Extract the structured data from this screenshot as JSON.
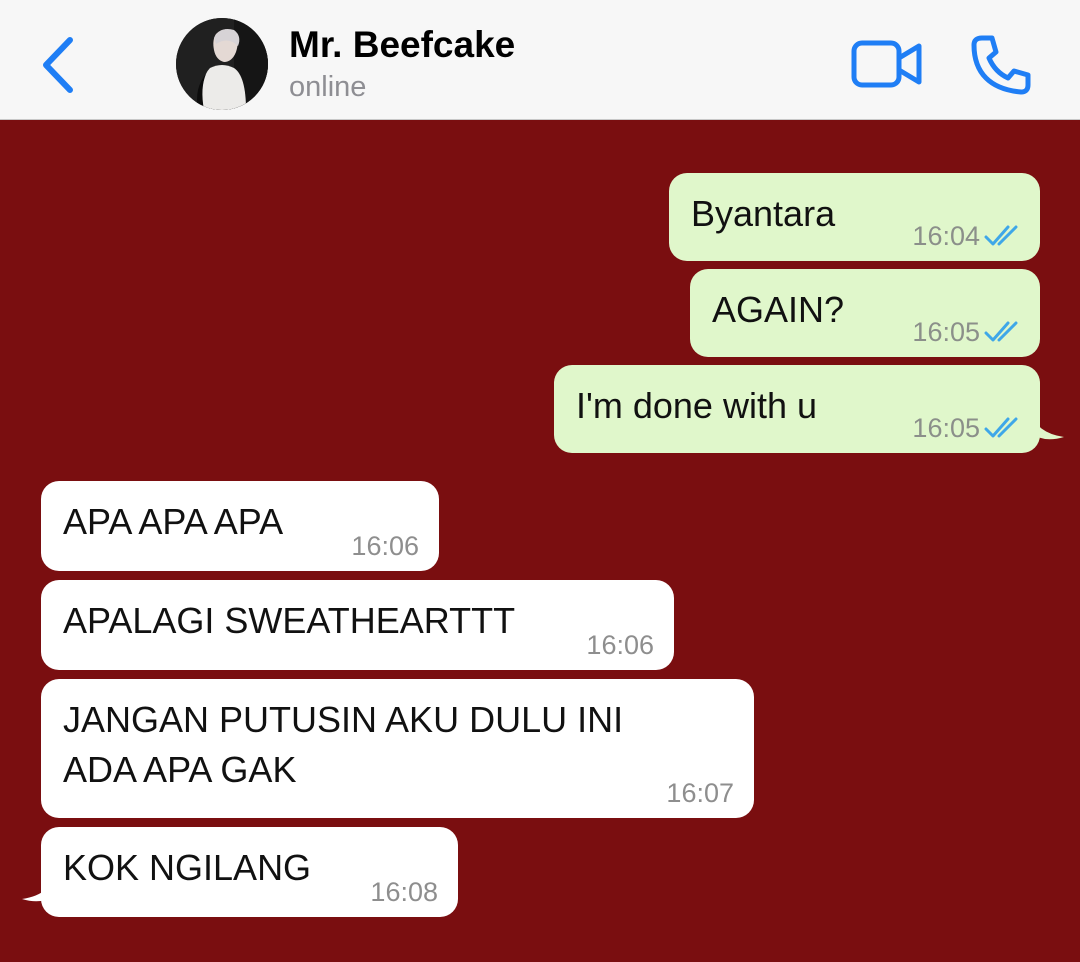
{
  "header": {
    "contact_name": "Mr. Beefcake",
    "status": "online",
    "accent_color": "#1f7ef5",
    "icons": [
      "chevron-left-icon",
      "video-camera-icon",
      "phone-icon"
    ]
  },
  "chat": {
    "background_color": "#7a0e10",
    "outgoing_bubble_color": "#e0f7cb",
    "incoming_bubble_color": "#ffffff",
    "read_receipt_color": "#3fa7e8",
    "messages": [
      {
        "direction": "outgoing",
        "text": "Byantara",
        "time": "16:04",
        "read": true
      },
      {
        "direction": "outgoing",
        "text": "AGAIN?",
        "time": "16:05",
        "read": true
      },
      {
        "direction": "outgoing",
        "text": "I'm done with u",
        "time": "16:05",
        "read": true
      },
      {
        "direction": "incoming",
        "text": "APA APA APA",
        "time": "16:06"
      },
      {
        "direction": "incoming",
        "text": "APALAGI SWEATHEARTTT",
        "time": "16:06"
      },
      {
        "direction": "incoming",
        "text": "JANGAN PUTUSIN AKU DULU INI ADA APA GAK",
        "time": "16:07"
      },
      {
        "direction": "incoming",
        "text": "KOK NGILANG",
        "time": "16:08"
      }
    ]
  }
}
